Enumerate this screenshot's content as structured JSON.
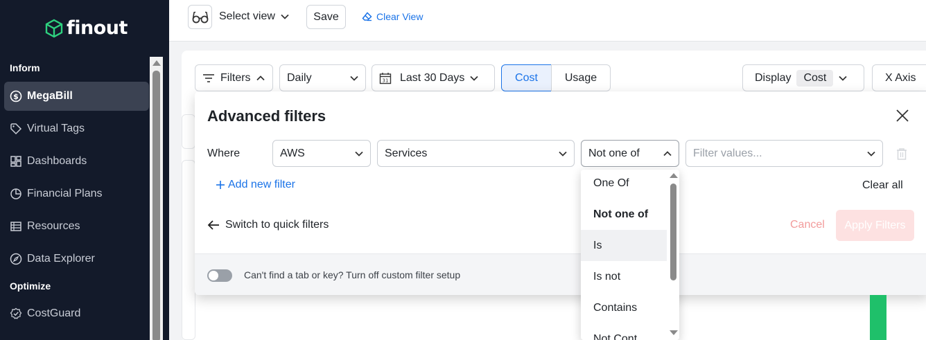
{
  "brand": {
    "name": "finout"
  },
  "sidebar": {
    "sections": {
      "inform": "Inform",
      "optimize": "Optimize"
    },
    "items": [
      {
        "label": "MegaBill"
      },
      {
        "label": "Virtual Tags"
      },
      {
        "label": "Dashboards"
      },
      {
        "label": "Financial Plans"
      },
      {
        "label": "Resources"
      },
      {
        "label": "Data Explorer"
      },
      {
        "label": "CostGuard"
      }
    ]
  },
  "topbar": {
    "select_view": "Select view",
    "save": "Save",
    "clear_view": "Clear View"
  },
  "toolbar": {
    "filters": "Filters",
    "granularity": "Daily",
    "date_range": "Last 30 Days",
    "cost": "Cost",
    "usage": "Usage",
    "display_label": "Display",
    "display_value": "Cost",
    "x_axis": "X Axis"
  },
  "advanced_filters": {
    "title": "Advanced filters",
    "where": "Where",
    "provider": "AWS",
    "dimension": "Services",
    "operator": "Not one of",
    "values_placeholder": "Filter values...",
    "add_new_filter": "Add new filter",
    "clear_all": "Clear all",
    "switch_quick": "Switch to quick filters",
    "cancel": "Cancel",
    "apply": "Apply Filters",
    "footer_text": "Can't find a tab or key? Turn off custom filter setup"
  },
  "operator_dropdown": {
    "options": [
      "One Of",
      "Not one of",
      "Is",
      "Is not",
      "Contains",
      "Not Cont"
    ]
  },
  "colors": {
    "sidebar_bg": "#131a2a",
    "accent_blue": "#1a73e8",
    "cancel_red": "#f29b9b",
    "apply_disabled": "#fde1e1",
    "chart_green": "#1fc06a"
  }
}
